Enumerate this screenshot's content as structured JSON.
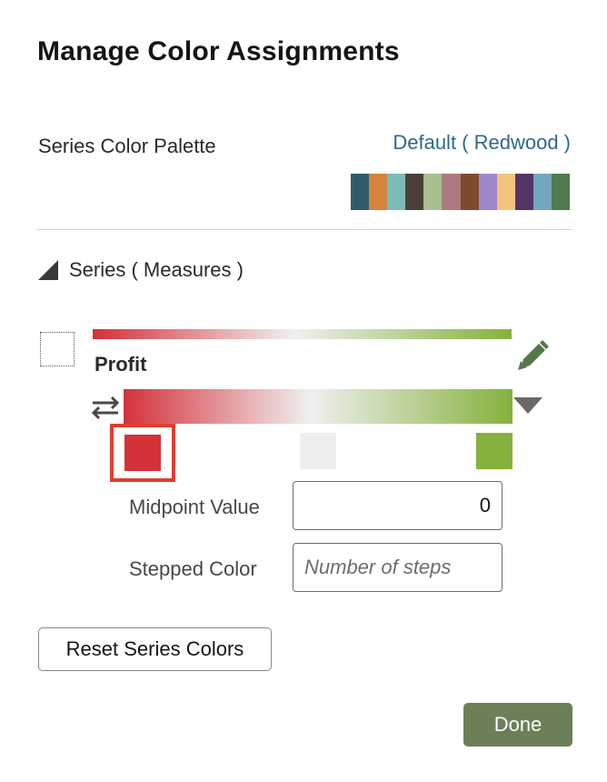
{
  "dialog": {
    "title": "Manage Color Assignments"
  },
  "palette": {
    "label": "Series Color Palette",
    "selected": "Default ( Redwood )",
    "swatches": [
      "#2e5c68",
      "#d4843c",
      "#7bbcb8",
      "#4b4038",
      "#a8c08d",
      "#ad7a80",
      "#7e4b2b",
      "#9f86c9",
      "#f4c27c",
      "#553468",
      "#72a7c0",
      "#4e7a4e"
    ]
  },
  "section": {
    "label": "Series ( Measures )",
    "expanded": true
  },
  "measure": {
    "name": "Profit",
    "checked": false,
    "gradient": {
      "start": "#d4313a",
      "mid": "#f0f0f0",
      "end": "#85b13c"
    }
  },
  "stops": {
    "start_color": "#d4313a",
    "mid_color": "#eeeeee",
    "end_color": "#85b13c"
  },
  "fields": {
    "midpoint_label": "Midpoint Value",
    "midpoint_value": "0",
    "stepped_label": "Stepped Color",
    "stepped_placeholder": "Number of steps"
  },
  "buttons": {
    "reset": "Reset Series Colors",
    "done": "Done"
  },
  "icons": {
    "collapse": "triangle-down-right-icon",
    "edit": "pencil-icon",
    "swap": "swap-arrows-icon",
    "dropdown": "caret-down-icon"
  }
}
